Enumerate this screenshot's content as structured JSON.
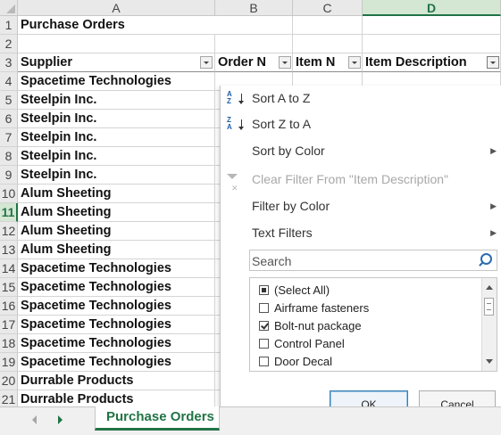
{
  "columns": [
    "A",
    "B",
    "C",
    "D"
  ],
  "selected_column": "D",
  "rows": [
    {
      "num": "1",
      "supplier": "Purchase Orders"
    },
    {
      "num": "2",
      "supplier": ""
    },
    {
      "num": "3",
      "supplier": "Supplier"
    },
    {
      "num": "4",
      "supplier": "Spacetime Technologies"
    },
    {
      "num": "5",
      "supplier": "Steelpin Inc."
    },
    {
      "num": "6",
      "supplier": "Steelpin Inc."
    },
    {
      "num": "7",
      "supplier": "Steelpin Inc."
    },
    {
      "num": "8",
      "supplier": "Steelpin Inc."
    },
    {
      "num": "9",
      "supplier": "Steelpin Inc."
    },
    {
      "num": "10",
      "supplier": "Alum Sheeting"
    },
    {
      "num": "11",
      "supplier": "Alum Sheeting"
    },
    {
      "num": "12",
      "supplier": "Alum Sheeting"
    },
    {
      "num": "13",
      "supplier": "Alum Sheeting"
    },
    {
      "num": "14",
      "supplier": "Spacetime Technologies"
    },
    {
      "num": "15",
      "supplier": "Spacetime Technologies"
    },
    {
      "num": "16",
      "supplier": "Spacetime Technologies"
    },
    {
      "num": "17",
      "supplier": "Spacetime Technologies"
    },
    {
      "num": "18",
      "supplier": "Spacetime Technologies"
    },
    {
      "num": "19",
      "supplier": "Spacetime Technologies"
    },
    {
      "num": "20",
      "supplier": "Durrable Products"
    },
    {
      "num": "21",
      "supplier": "Durrable Products"
    }
  ],
  "selected_row": "11",
  "headers": {
    "supplier": "Supplier",
    "order_no": "Order N",
    "item_no": "Item N",
    "item_description": "Item Description"
  },
  "filter_menu": {
    "sort_a_z": "Sort A to Z",
    "sort_z_a": "Sort Z to A",
    "sort_by_color": "Sort by Color",
    "clear_filter": "Clear Filter From \"Item Description\"",
    "filter_by_color": "Filter by Color",
    "text_filters": "Text Filters",
    "search_placeholder": "Search",
    "items": [
      {
        "label": "(Select All)",
        "state": "indeterminate"
      },
      {
        "label": "Airframe fasteners",
        "state": "unchecked"
      },
      {
        "label": "Bolt-nut package",
        "state": "checked"
      },
      {
        "label": "Control Panel",
        "state": "unchecked"
      },
      {
        "label": "Door Decal",
        "state": "unchecked"
      }
    ],
    "ok_label": "OK",
    "cancel_label": "Cancel"
  },
  "sheet_tab": "Purchase Orders",
  "colors": {
    "accent": "#217346",
    "selection_fill": "#d3e7d3"
  }
}
